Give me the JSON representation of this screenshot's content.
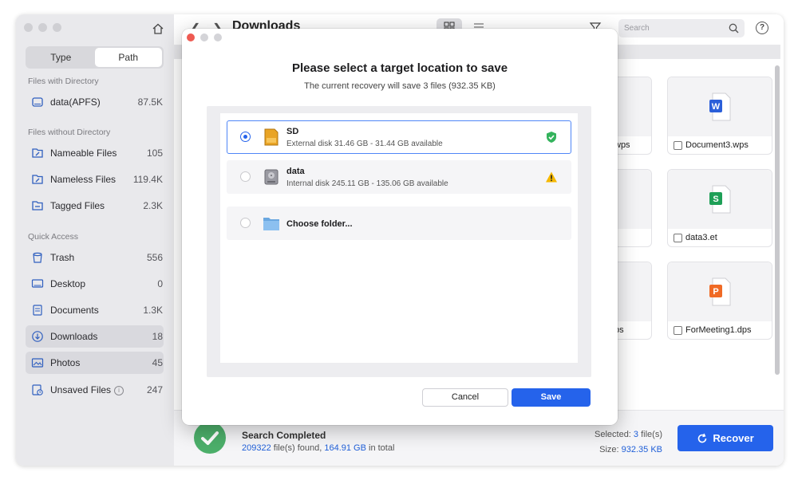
{
  "sidebar": {
    "tabs": [
      "Type",
      "Path"
    ],
    "active_tab": "Path",
    "sections": {
      "with_directory": "Files with Directory",
      "without_directory": "Files without Directory",
      "quick_access": "Quick Access"
    },
    "items": [
      {
        "label": "data(APFS)",
        "count": "87.5K",
        "icon": "drive-icon"
      },
      {
        "label": "Nameable Files",
        "count": "105",
        "icon": "folder-tag-icon"
      },
      {
        "label": "Nameless Files",
        "count": "119.4K",
        "icon": "folder-tag-icon"
      },
      {
        "label": "Tagged Files",
        "count": "2.3K",
        "icon": "folder-icon"
      },
      {
        "label": "Trash",
        "count": "556",
        "icon": "trash-icon"
      },
      {
        "label": "Desktop",
        "count": "0",
        "icon": "desktop-icon"
      },
      {
        "label": "Documents",
        "count": "1.3K",
        "icon": "document-icon"
      },
      {
        "label": "Downloads",
        "count": "18",
        "icon": "download-icon"
      },
      {
        "label": "Photos",
        "count": "45",
        "icon": "photo-icon"
      },
      {
        "label": "Unsaved Files",
        "count": "247",
        "icon": "unsaved-icon"
      }
    ]
  },
  "header": {
    "title": "Downloads",
    "search_placeholder": "Search"
  },
  "files": [
    {
      "name": "wps",
      "app": "wps"
    },
    {
      "name": "Document3.wps",
      "app": "word",
      "letter": "W",
      "color": "#2b5fd9"
    },
    {
      "name": "data3.et",
      "app": "sheet",
      "letter": "S",
      "color": "#1e9f57"
    },
    {
      "name": "ps",
      "app": "wps"
    },
    {
      "name": "ForMeeting1.dps",
      "app": "present",
      "letter": "P",
      "color": "#f06a25"
    }
  ],
  "footer": {
    "status_title": "Search Completed",
    "files_found": "209322",
    "files_found_suffix": " file(s) found, ",
    "total_size": "164.91 GB",
    "total_suffix": " in total",
    "selected_label": "Selected: ",
    "selected_count": "3",
    "selected_suffix": " file(s)",
    "size_label": "Size: ",
    "size_value": "932.35 KB",
    "recover_label": "Recover"
  },
  "dialog": {
    "title": "Please select a target location to save",
    "subtitle": "The current recovery will save 3 files (932.35 KB)",
    "options": [
      {
        "name": "SD",
        "desc": "External disk 31.46 GB - 31.44 GB available",
        "selected": true,
        "status": "ok"
      },
      {
        "name": "data",
        "desc": "Internal disk 245.11 GB - 135.06 GB available",
        "selected": false,
        "status": "warning"
      },
      {
        "name": "Choose folder...",
        "desc": "",
        "selected": false,
        "status": ""
      }
    ],
    "cancel_label": "Cancel",
    "save_label": "Save"
  },
  "colors": {
    "accent": "#2563eb",
    "success": "#4caf6a",
    "warning": "#f5b800"
  }
}
